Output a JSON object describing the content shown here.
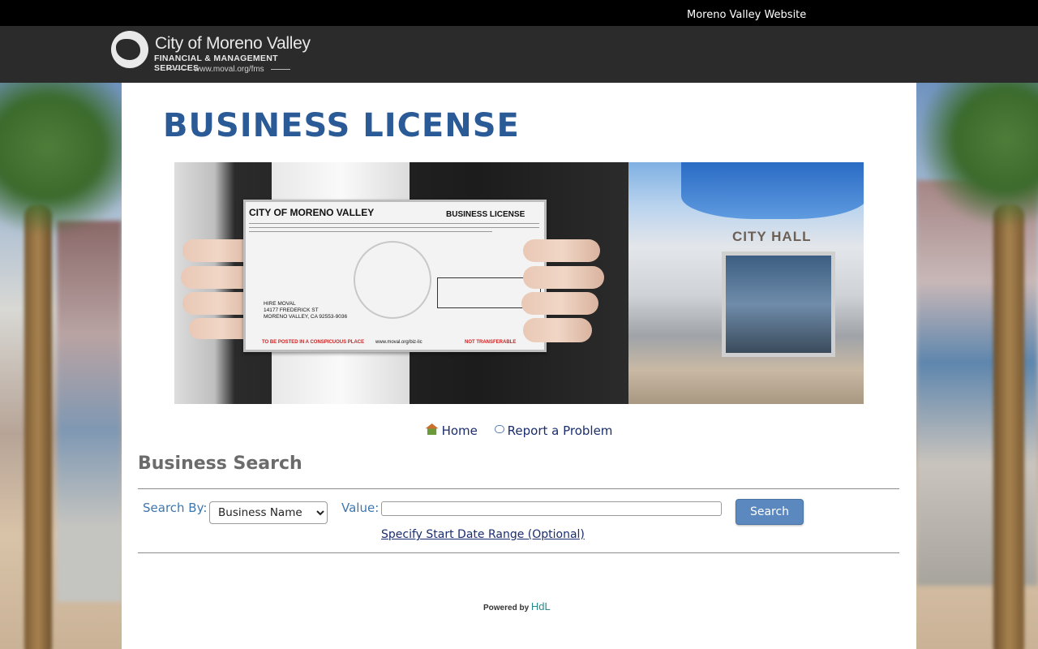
{
  "topbar": {
    "website_link": "Moreno Valley Website"
  },
  "logo": {
    "line1": "City of Moreno Valley",
    "line2": "FINANCIAL & MANAGEMENT SERVICES",
    "line3": "www.moval.org/fms"
  },
  "page_title": "BUSINESS LICENSE",
  "hero": {
    "card_title": "CITY OF MORENO VALLEY",
    "card_type": "BUSINESS LICENSE",
    "card_address_1": "HIRE MOVAL",
    "card_address_2": "14177 FREDERICK ST",
    "card_address_3": "MORENO VALLEY, CA 92553-9036",
    "card_footer_left": "TO BE POSTED IN A CONSPICUOUS PLACE",
    "card_footer_center": "www.moval.org/biz-lic",
    "card_footer_right": "NOT TRANSFERABLE",
    "building_sign": "CITY HALL"
  },
  "nav": {
    "home": "Home",
    "report": "Report a Problem"
  },
  "search": {
    "section_title": "Business Search",
    "search_by_label": "Search By:",
    "search_by_selected": "Business Name",
    "value_label": "Value:",
    "value_input": "",
    "search_button": "Search",
    "date_range_link": "Specify Start Date Range (Optional)"
  },
  "footer": {
    "powered_by": "Powered by",
    "brand": "HdL"
  },
  "colors": {
    "title_blue": "#2b5b96",
    "label_blue": "#3d77ae",
    "button_blue": "#5b88be",
    "link_navy": "#1a2d6e"
  }
}
